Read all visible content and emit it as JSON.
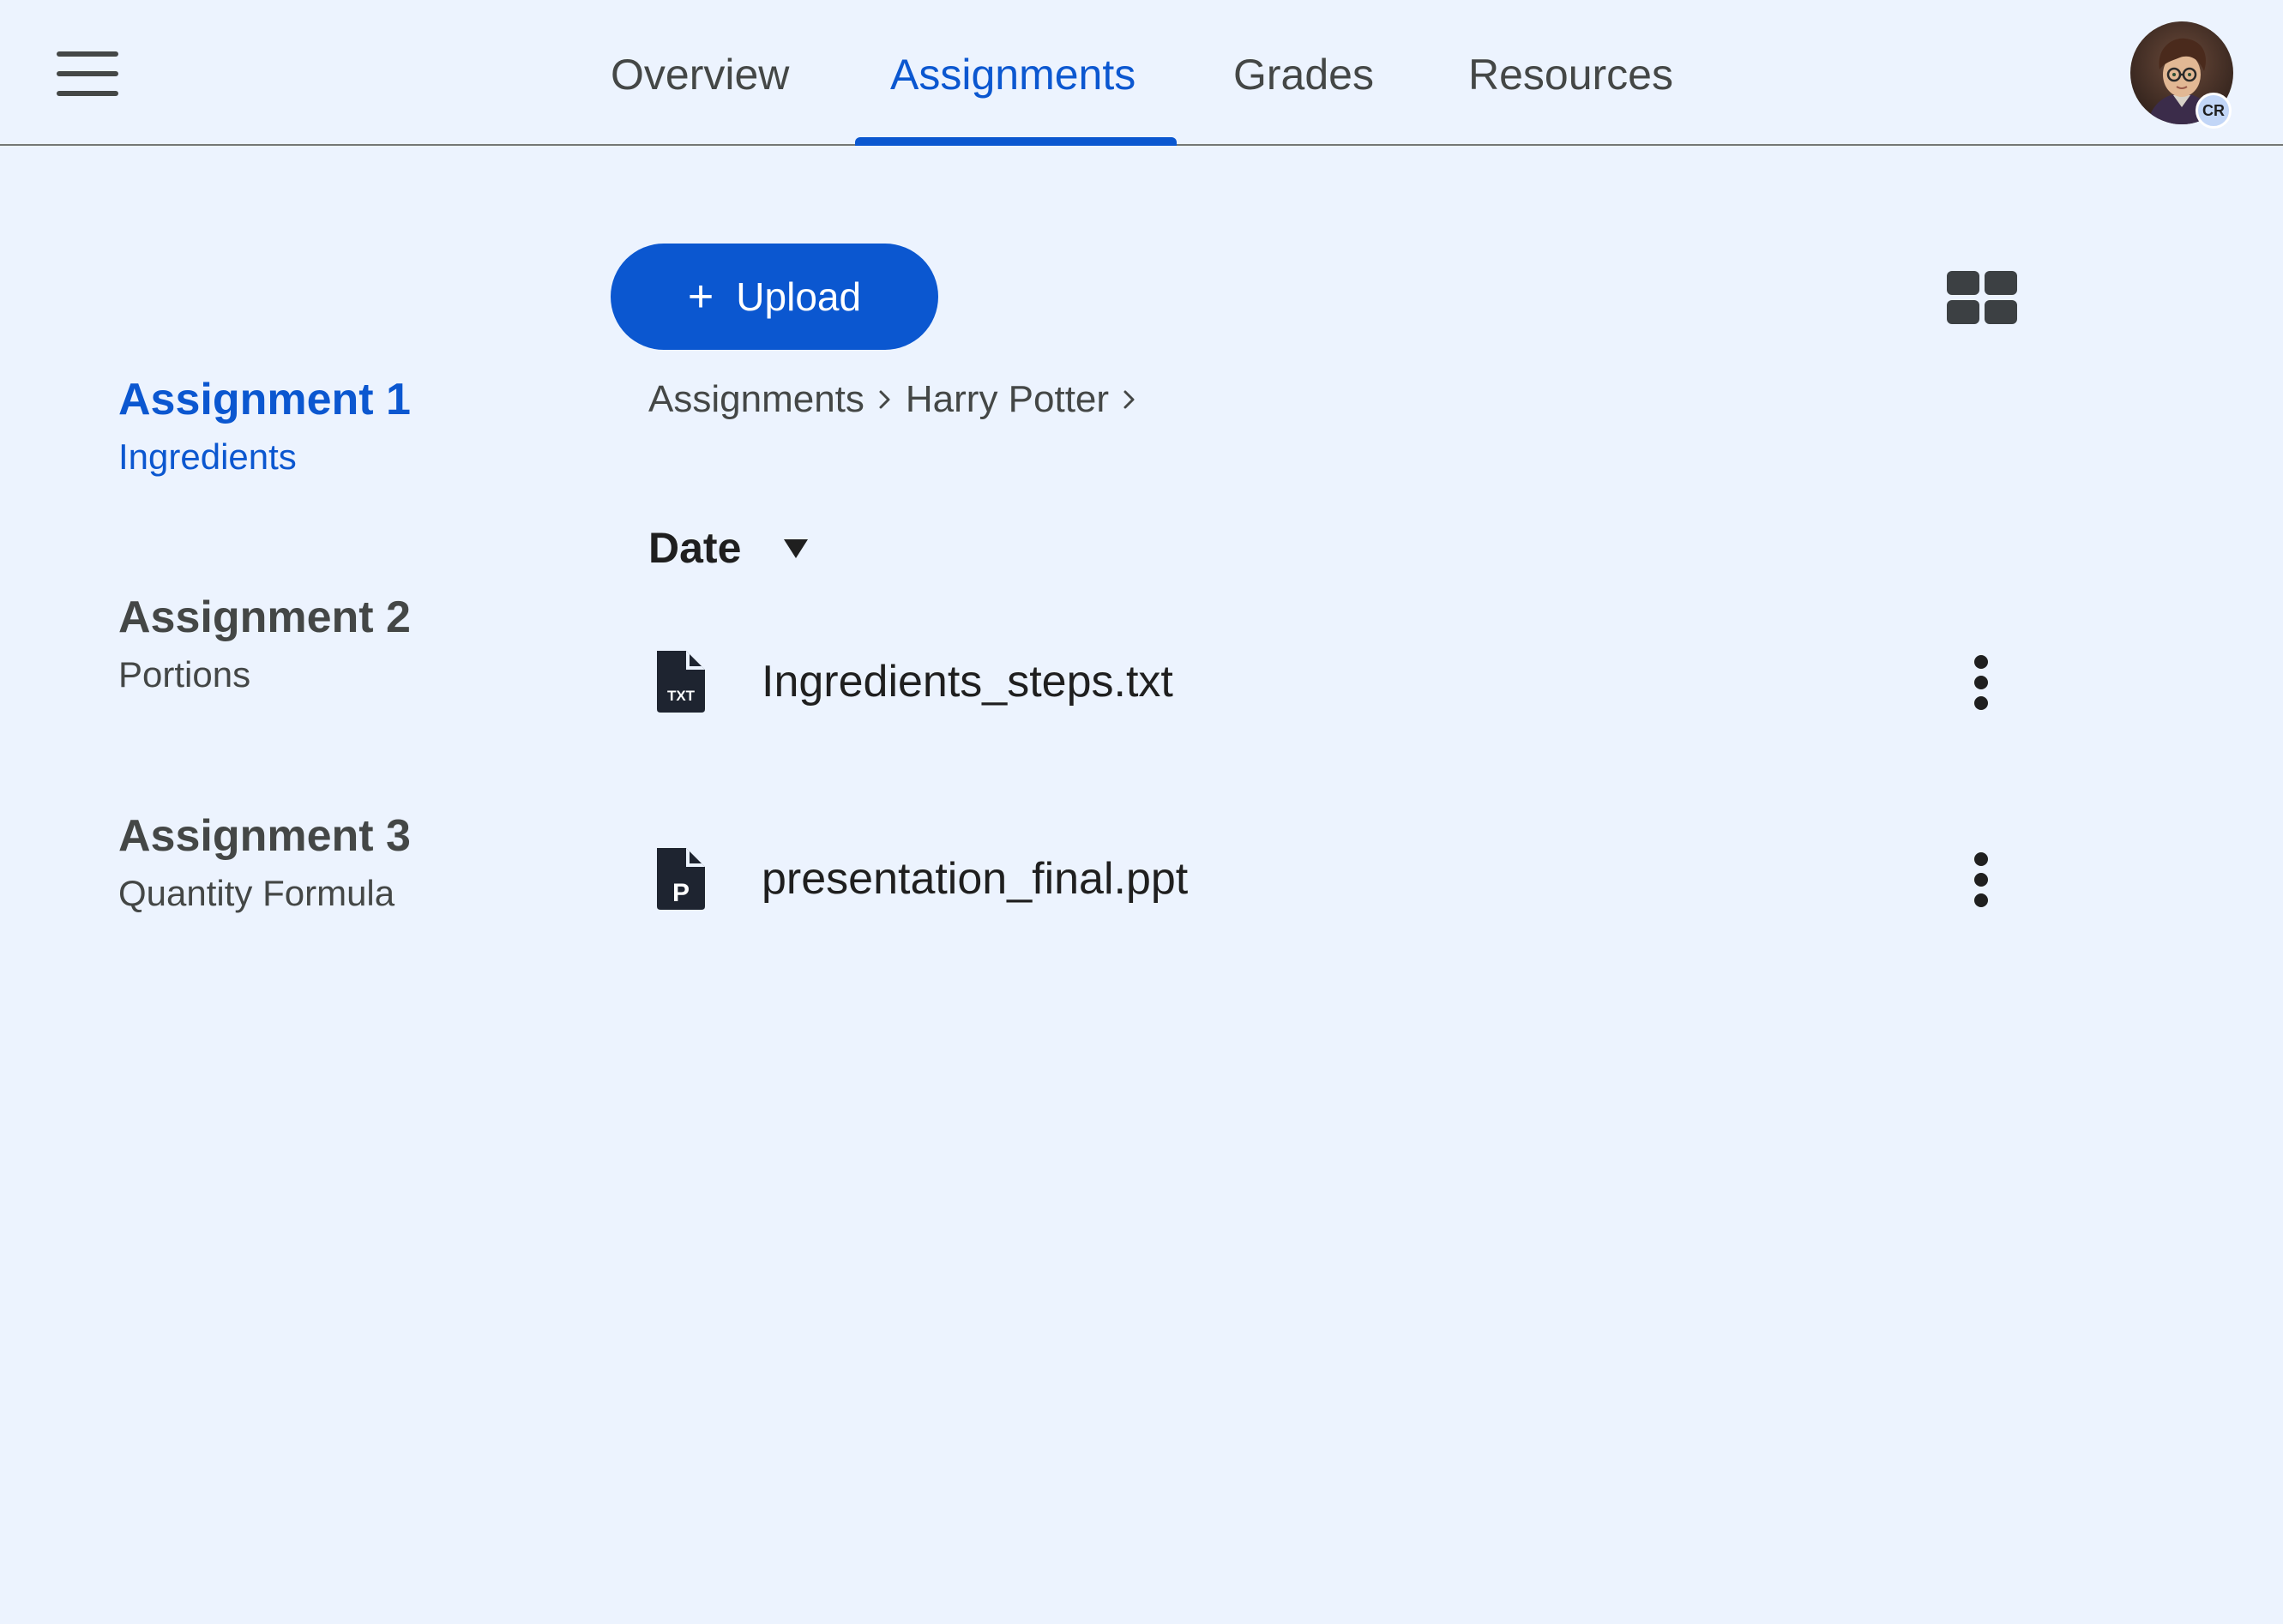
{
  "nav": {
    "menu_icon": "hamburger-menu-icon",
    "tabs": [
      {
        "label": "Overview",
        "active": false
      },
      {
        "label": "Assignments",
        "active": true
      },
      {
        "label": "Grades",
        "active": false
      },
      {
        "label": "Resources",
        "active": false
      }
    ],
    "avatar_badge": "CR"
  },
  "sidebar": {
    "items": [
      {
        "title": "Assignment 1",
        "subtitle": "Ingredients",
        "active": true
      },
      {
        "title": "Assignment 2",
        "subtitle": "Portions",
        "active": false
      },
      {
        "title": "Assignment 3",
        "subtitle": "Quantity Formula",
        "active": false
      }
    ]
  },
  "toolbar": {
    "upload_icon": "plus-icon",
    "upload_label": "Upload",
    "view_icon": "grid-view-icon"
  },
  "breadcrumb": {
    "items": [
      "Assignments",
      "Harry Potter"
    ]
  },
  "sort": {
    "label": "Date",
    "icon": "triangle-down-icon"
  },
  "files": [
    {
      "name": "Ingredients_steps.txt",
      "icon": "txt-file-icon",
      "icon_text": "TXT"
    },
    {
      "name": "presentation_final.ppt",
      "icon": "ppt-file-icon",
      "icon_text": "P"
    }
  ],
  "colors": {
    "background": "#ecf3fe",
    "accent": "#0b57d0",
    "text": "#1f1f1f",
    "muted_text": "#444746"
  }
}
